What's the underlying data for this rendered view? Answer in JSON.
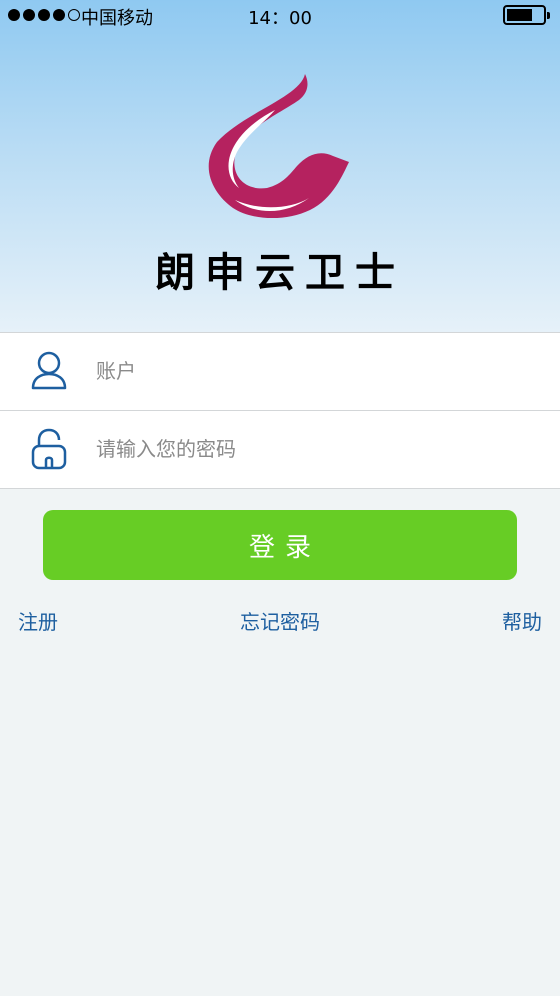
{
  "status_bar": {
    "carrier": "中国移动",
    "time": "14：00",
    "signal_bars_filled": 4,
    "signal_bars_total": 5
  },
  "brand": {
    "name": "朗申云卫士",
    "logo_icon": "swan-logo-icon",
    "logo_color": "#b5225f"
  },
  "login_form": {
    "account_placeholder": "账户",
    "account_icon": "user-icon",
    "password_placeholder": "请输入您的密码",
    "password_icon": "unlock-icon",
    "login_label": "登录",
    "login_color": "#67cd25"
  },
  "links": {
    "register": "注册",
    "forgot_password": "忘记密码",
    "help": "帮助"
  }
}
